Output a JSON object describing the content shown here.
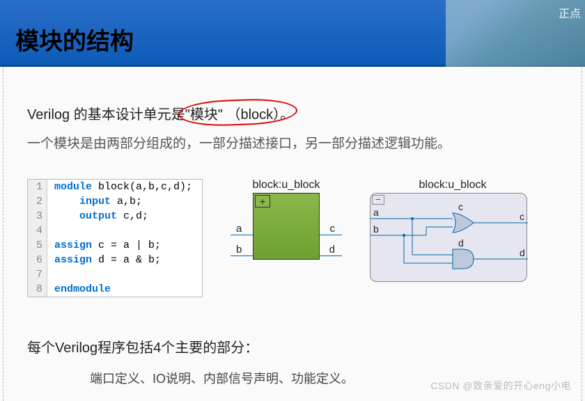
{
  "header": {
    "title": "模块的结构",
    "corner": "正点"
  },
  "intro": {
    "prefix": "Verilog 的基本设计单元是",
    "circled": "\"模块\"  （block）。"
  },
  "desc": "一个模块是由两部分组成的，一部分描述接口，另一部分描述逻辑功能。",
  "code": {
    "lines": [
      {
        "n": "1",
        "kw": "module",
        "rest": " block(a,b,c,d);"
      },
      {
        "n": "2",
        "kw": "    input",
        "rest": " a,b;"
      },
      {
        "n": "3",
        "kw": "    output",
        "rest": " c,d;"
      },
      {
        "n": "4",
        "kw": "",
        "rest": ""
      },
      {
        "n": "5",
        "kw": "assign",
        "rest": " c = a | b;"
      },
      {
        "n": "6",
        "kw": "assign",
        "rest": " d = a & b;"
      },
      {
        "n": "7",
        "kw": "",
        "rest": ""
      },
      {
        "n": "8",
        "kw": "endmodule",
        "rest": ""
      }
    ]
  },
  "schematic": {
    "label": "block:u_block",
    "plus": "+",
    "ports": {
      "a": "a",
      "b": "b",
      "c": "c",
      "d": "d"
    }
  },
  "gates": {
    "label": "block:u_block",
    "minus": "−",
    "a": "a",
    "b": "b",
    "c": "c",
    "d": "d",
    "gate_or": "c",
    "gate_and": "d"
  },
  "section2": {
    "title": "每个Verilog程序包括4个主要的部分：",
    "items": "端口定义、IO说明、内部信号声明、功能定义。"
  },
  "watermark": "CSDN @致亲爱的开心eng小电"
}
